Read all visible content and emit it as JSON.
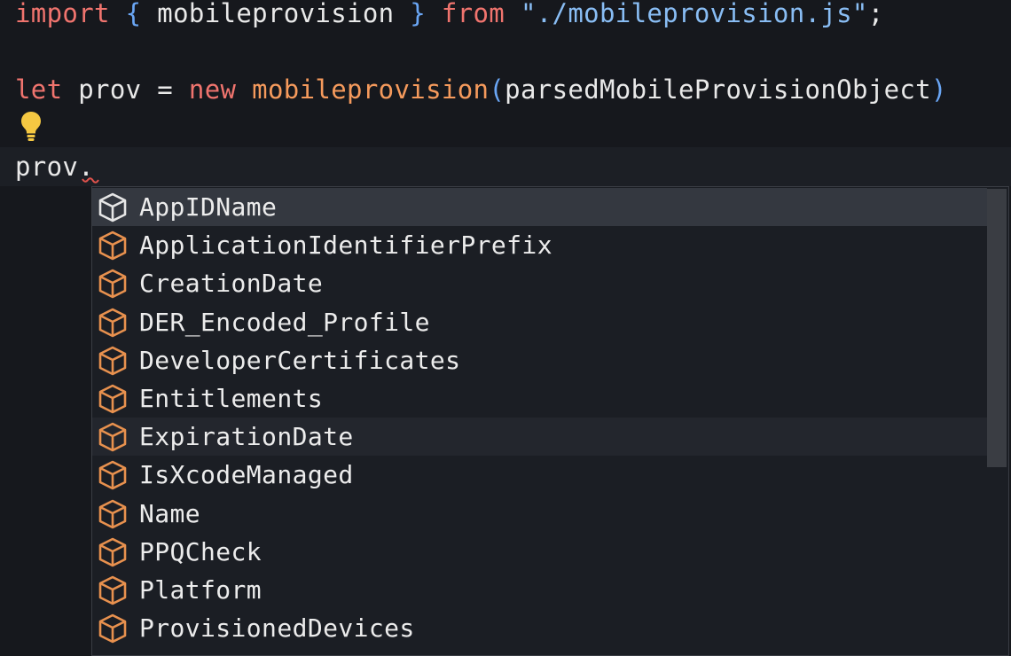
{
  "editor": {
    "line1": {
      "kw_import": "import",
      "brace_open": "{",
      "name": " mobileprovision ",
      "brace_close": "}",
      "kw_from": "from",
      "path": "\"./mobileprovision.js\"",
      "semicolon": ";"
    },
    "line3": {
      "kw_let": "let",
      "var": " prov = ",
      "kw_new": "new",
      "ctor": "mobileprovision",
      "paren_open": "(",
      "arg": "parsedMobileProvisionObject",
      "paren_close": ")"
    },
    "line5": {
      "text": "prov."
    }
  },
  "colors": {
    "keyword": "#f0746e",
    "function": "#f59a5c",
    "string": "#89bdf4",
    "lightbulb": "#f5c842",
    "property_icon": "#e8914e",
    "selected_icon": "#e6e6e6"
  },
  "suggestions": {
    "icon": "property-cube-icon",
    "items": [
      {
        "label": "AppIDName"
      },
      {
        "label": "ApplicationIdentifierPrefix"
      },
      {
        "label": "CreationDate"
      },
      {
        "label": "DER_Encoded_Profile"
      },
      {
        "label": "DeveloperCertificates"
      },
      {
        "label": "Entitlements"
      },
      {
        "label": "ExpirationDate"
      },
      {
        "label": "IsXcodeManaged"
      },
      {
        "label": "Name"
      },
      {
        "label": "PPQCheck"
      },
      {
        "label": "Platform"
      },
      {
        "label": "ProvisionedDevices"
      }
    ]
  }
}
